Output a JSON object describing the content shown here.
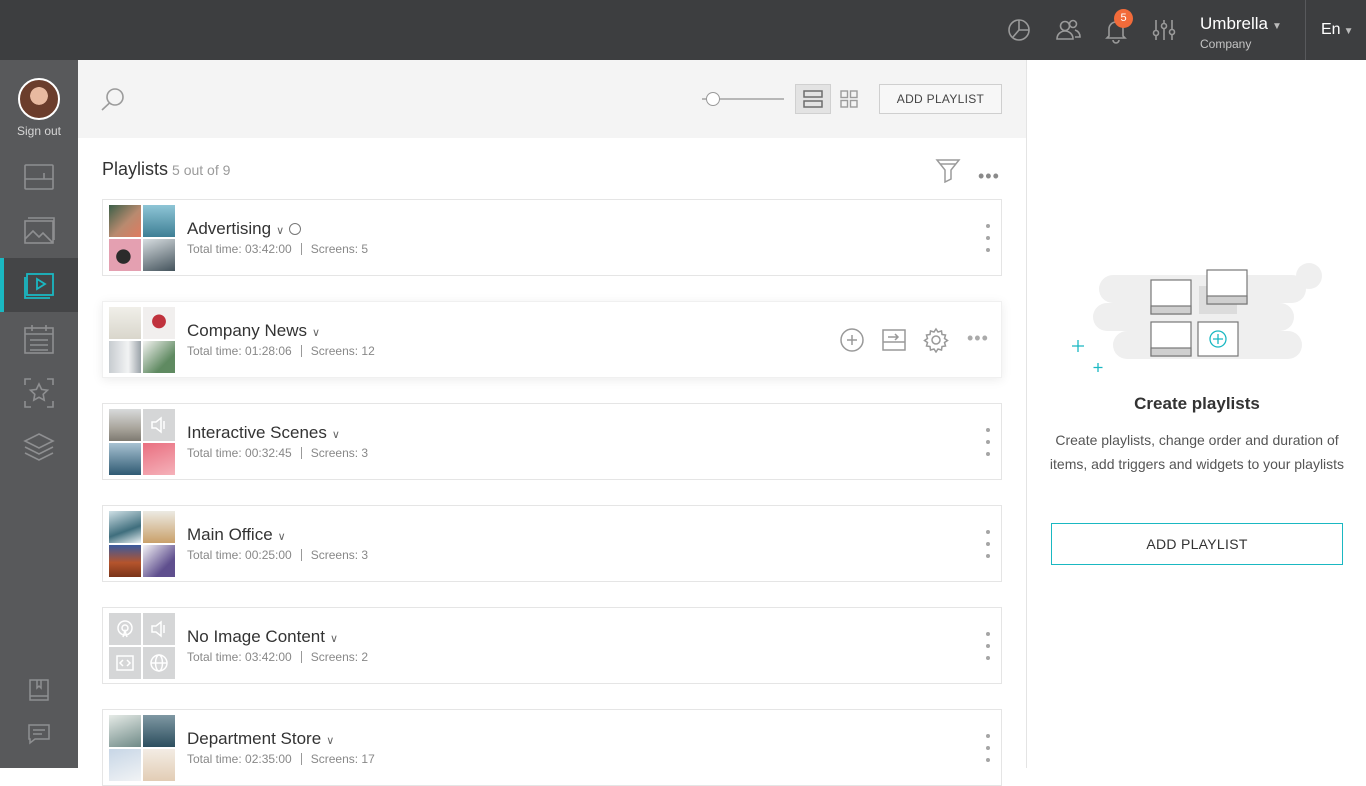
{
  "topbar": {
    "notifications_count": "5",
    "org_name": "Umbrella",
    "org_sub": "Company",
    "language": "En",
    "icons": [
      "analytics-icon",
      "users-icon",
      "bell-icon",
      "sliders-icon"
    ]
  },
  "sidebar": {
    "sign_out": "Sign out",
    "items": [
      "screens-icon",
      "media-icon",
      "playlists-icon",
      "schedule-icon",
      "widgets-icon",
      "layers-icon"
    ],
    "active": "playlists-icon",
    "bottom": [
      "docs-icon",
      "chat-icon"
    ]
  },
  "toolbar": {
    "add_label": "ADD PLAYLIST"
  },
  "list": {
    "title": "Playlists",
    "count": "5 out of 9",
    "rows": [
      {
        "name": "Advertising",
        "time_label": "Total time: 03:42:00",
        "screens_label": "Screens: 5",
        "scheduled": true
      },
      {
        "name": "Company News",
        "time_label": "Total time: 01:28:06",
        "screens_label": "Screens: 12",
        "scheduled": false
      },
      {
        "name": "Interactive Scenes",
        "time_label": "Total time: 00:32:45",
        "screens_label": "Screens: 3",
        "scheduled": false
      },
      {
        "name": "Main Office",
        "time_label": "Total time: 00:25:00",
        "screens_label": "Screens: 3",
        "scheduled": false
      },
      {
        "name": "No Image Content",
        "time_label": "Total time: 03:42:00",
        "screens_label": "Screens: 2",
        "scheduled": false
      },
      {
        "name": "Department Store",
        "time_label": "Total time: 02:35:00",
        "screens_label": "Screens: 17",
        "scheduled": false
      }
    ]
  },
  "panel": {
    "title": "Create playlists",
    "description": "Create playlists, change order and duration of items, add triggers and widgets to your playlists",
    "button": "ADD PLAYLIST"
  },
  "colors": {
    "accent": "#1ab8c2",
    "topbar": "#3d3e40",
    "sidebar": "#58595b",
    "badge": "#f26b3a"
  }
}
